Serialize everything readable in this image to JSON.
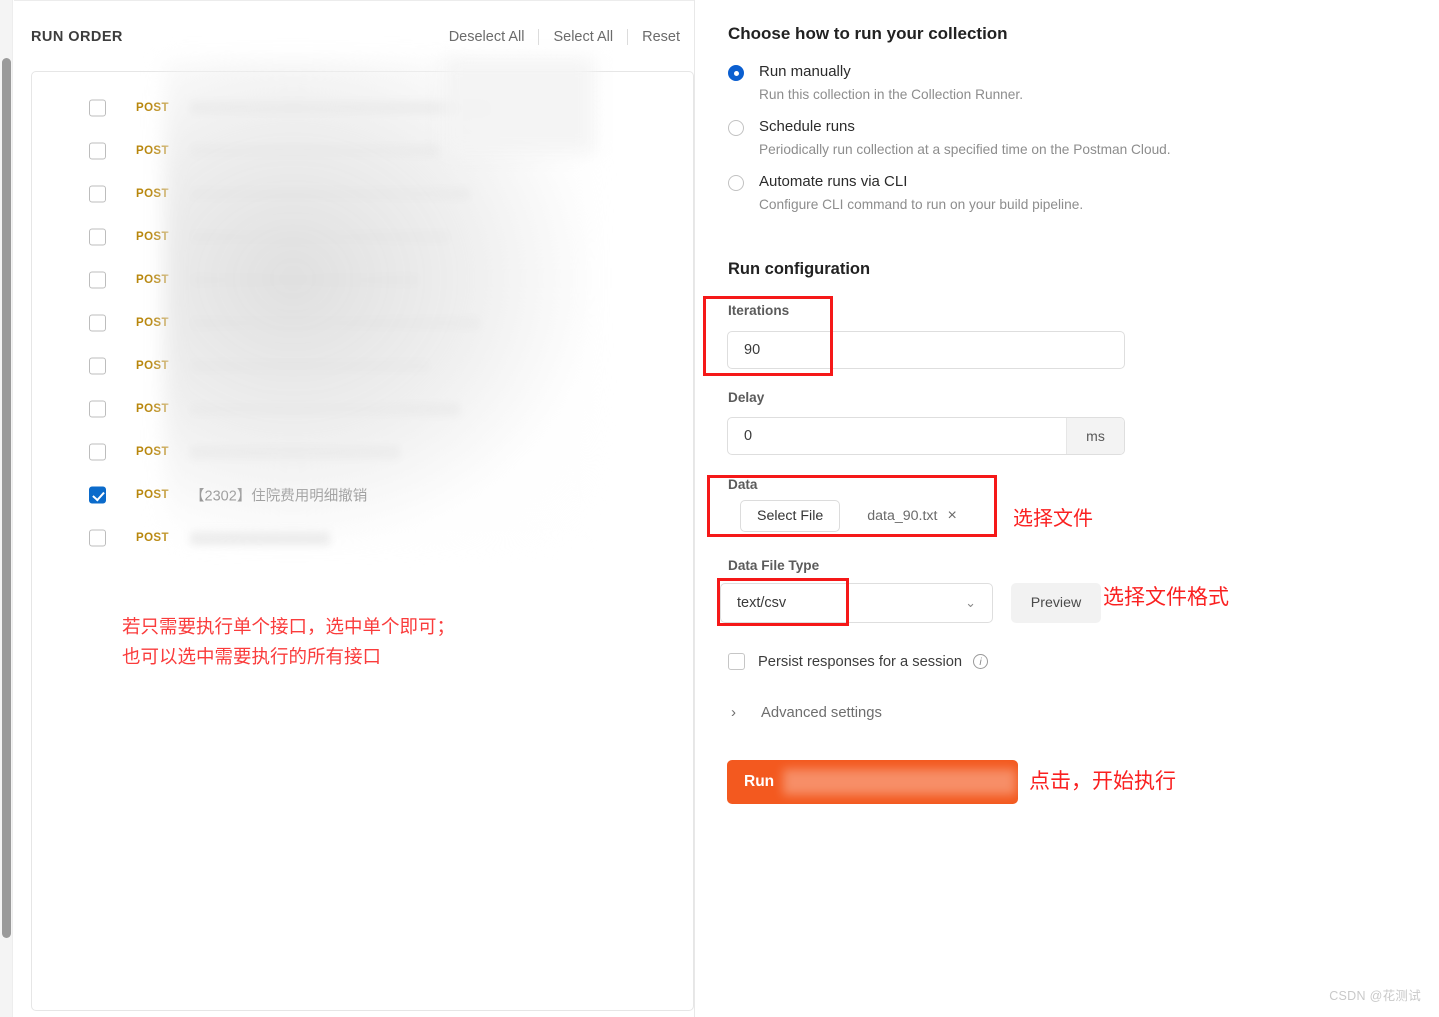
{
  "left_panel": {
    "title": "RUN ORDER",
    "actions": [
      {
        "label": "Deselect All"
      },
      {
        "label": "Select All"
      },
      {
        "label": "Reset"
      }
    ],
    "requests": [
      {
        "method": "POST",
        "name": "",
        "checked": false,
        "redacted": true
      },
      {
        "method": "POST",
        "name": "",
        "checked": false,
        "redacted": true
      },
      {
        "method": "POST",
        "name": "",
        "checked": false,
        "redacted": true
      },
      {
        "method": "POST",
        "name": "",
        "checked": false,
        "redacted": true
      },
      {
        "method": "POST",
        "name": "",
        "checked": false,
        "redacted": true
      },
      {
        "method": "POST",
        "name": "",
        "checked": false,
        "redacted": true
      },
      {
        "method": "POST",
        "name": "",
        "checked": false,
        "redacted": true
      },
      {
        "method": "POST",
        "name": "",
        "checked": false,
        "redacted": true
      },
      {
        "method": "POST",
        "name": "",
        "checked": false,
        "redacted": true
      },
      {
        "method": "POST",
        "name": "【2302】住院费用明细撤销",
        "checked": true,
        "redacted": false
      },
      {
        "method": "POST",
        "name": "",
        "checked": false,
        "redacted": true
      }
    ],
    "annotation": "若只需要执行单个接口，选中单个即可；\n也可以选中需要执行的所有接口"
  },
  "right_panel": {
    "title": "Choose how to run your collection",
    "run_modes": [
      {
        "label": "Run manually",
        "desc": "Run this collection in the Collection Runner.",
        "selected": true
      },
      {
        "label": "Schedule runs",
        "desc": "Periodically run collection at a specified time on the Postman Cloud.",
        "selected": false
      },
      {
        "label": "Automate runs via CLI",
        "desc": "Configure CLI command to run on your build pipeline.",
        "selected": false
      }
    ],
    "run_configuration": {
      "title": "Run configuration",
      "iterations": {
        "label": "Iterations",
        "value": "90"
      },
      "delay": {
        "label": "Delay",
        "value": "0",
        "unit": "ms"
      },
      "data": {
        "label": "Data",
        "select_file_label": "Select File",
        "file_name": "data_90.txt",
        "clear_icon": "×"
      },
      "data_file_type": {
        "label": "Data File Type",
        "value": "text/csv",
        "chevron": "⌄",
        "preview_label": "Preview"
      },
      "persist": {
        "label": "Persist responses for a session",
        "checked": false,
        "info": "i"
      },
      "advanced": {
        "label": "Advanced settings",
        "chevron": "›"
      },
      "run_button": {
        "label": "Run"
      }
    },
    "annotations": {
      "select_file": "选择文件",
      "file_format": "选择文件格式",
      "run": "点击，开始执行"
    }
  },
  "watermark": "CSDN @花测试"
}
